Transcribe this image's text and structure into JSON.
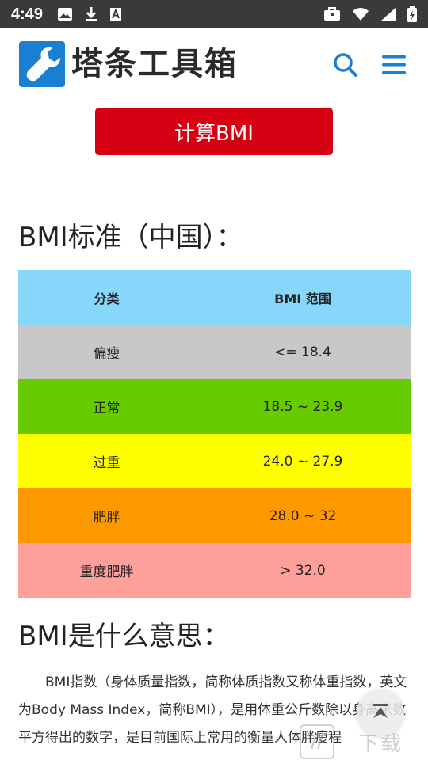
{
  "status_bar": {
    "time": "4:49",
    "left_icons": [
      "image-icon",
      "download-icon",
      "font-icon"
    ],
    "right_icons": [
      "briefcase-icon",
      "wifi-icon",
      "signal-icon",
      "battery-icon"
    ]
  },
  "header": {
    "logo_text": "塔条工具箱",
    "brand_color": "#1a7fd0",
    "icons": [
      "search-icon",
      "menu-icon"
    ]
  },
  "calc_button": {
    "label": "计算BMI",
    "color": "#d70012"
  },
  "standard_section": {
    "title": "BMI标准（中国）：",
    "table": {
      "headers": [
        "分类",
        "BMI 范围"
      ],
      "header_color": "#87d7fa",
      "rows": [
        {
          "category": "偏瘦",
          "range": "<= 18.4",
          "color": "#c8c8c8"
        },
        {
          "category": "正常",
          "range": "18.5 ~ 23.9",
          "color": "#66cc00"
        },
        {
          "category": "过重",
          "range": "24.0 ~ 27.9",
          "color": "#ffff00"
        },
        {
          "category": "肥胖",
          "range": "28.0 ~ 32",
          "color": "#ff9900"
        },
        {
          "category": "重度肥胖",
          "range": "> 32.0",
          "color": "#ffa09a"
        }
      ]
    }
  },
  "meaning_section": {
    "title": "BMI是什么意思：",
    "text": "BMI指数（身体质量指数，简称体质指数又称体重指数，英文为Body Mass Index，简称BMI），是用体重公斤数除以身高米数平方得出的数字，是目前国际上常用的衡量人体胖瘦程"
  },
  "watermark": {
    "text": "下载"
  }
}
